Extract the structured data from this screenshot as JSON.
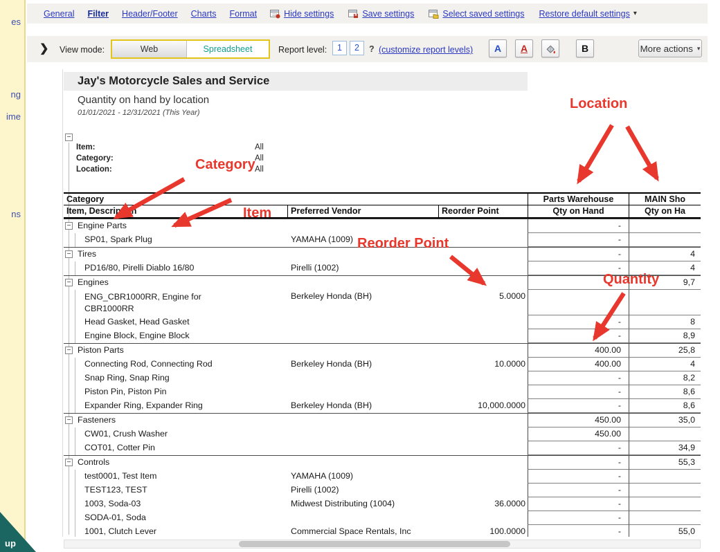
{
  "colors": {
    "link_blue": "#2b38c0",
    "active_tab_blue": "#182d9a",
    "annotation_red": "#e8382d",
    "spreadsheet_teal": "#0f9d8f",
    "toggle_gold_border": "#e3c419",
    "toolbar_bg": "#f2f1ee",
    "sidebar_yellow": "#fdf6cd",
    "corner_teal": "#1b6660"
  },
  "sidebar": {
    "fragments": [
      "es",
      "ng",
      "ime",
      "ns"
    ],
    "corner_label": "up"
  },
  "tabs": [
    {
      "label": "General"
    },
    {
      "label": "Filter"
    },
    {
      "label": "Header/Footer"
    },
    {
      "label": "Charts"
    },
    {
      "label": "Format"
    }
  ],
  "settings_links": [
    {
      "label": "Hide settings"
    },
    {
      "label": "Save settings"
    },
    {
      "label": "Select saved settings"
    },
    {
      "label": "Restore default settings",
      "caret": "▾"
    }
  ],
  "toolbar": {
    "collapse_chevron": "❯",
    "view_mode_label": "View mode:",
    "view_mode_web": "Web",
    "view_mode_spreadsheet": "Spreadsheet",
    "report_level_label": "Report level:",
    "level_1": "1",
    "level_2": "2",
    "help": "?",
    "customize_link": "(customize report levels)",
    "font_button": "A",
    "underline_button": "A",
    "bold_button": "B",
    "more_actions": "More actions",
    "more_actions_caret": "▾"
  },
  "report": {
    "company": "Jay's Motorcycle Sales and Service",
    "title": "Quantity on hand by location",
    "date_range": "01/01/2021 - 12/31/2021 (This Year)",
    "expander_glyph": "−",
    "filters": [
      {
        "label": "Item:",
        "value": "All"
      },
      {
        "label": "Category:",
        "value": "All"
      },
      {
        "label": "Location:",
        "value": "All"
      }
    ],
    "header": {
      "category": "Category",
      "item": "Item, Description",
      "vendor": "Preferred Vendor",
      "reorder": "Reorder Point",
      "loc1": "Parts Warehouse",
      "loc1_sub": "Qty on Hand",
      "loc2": "MAIN Sho",
      "loc2_sub": "Qty on Ha"
    },
    "rows": [
      {
        "type": "category",
        "name": "Engine Parts",
        "vendor": "",
        "reorder": "",
        "qty1": "-",
        "qty2": ""
      },
      {
        "type": "item",
        "name": "SP01, Spark Plug",
        "vendor": "YAMAHA (1009)",
        "reorder": "",
        "qty1": "-",
        "qty2": ""
      },
      {
        "type": "category",
        "name": "Tires",
        "vendor": "",
        "reorder": "",
        "qty1": "-",
        "qty2": "4"
      },
      {
        "type": "item",
        "name": "PD16/80, Pirelli Diablo 16/80",
        "vendor": "Pirelli (1002)",
        "reorder": "",
        "qty1": "-",
        "qty2": "4"
      },
      {
        "type": "category",
        "name": "Engines",
        "vendor": "",
        "reorder": "",
        "qty1": "",
        "qty2": "9,7"
      },
      {
        "type": "item",
        "name": "ENG_CBR1000RR, Engine for CBR1000RR",
        "vendor": "Berkeley Honda (BH)",
        "reorder": "5.0000",
        "qty1": "",
        "qty2": "",
        "tall": true
      },
      {
        "type": "item",
        "name": "Head Gasket, Head Gasket",
        "vendor": "",
        "reorder": "",
        "qty1": "-",
        "qty2": "8"
      },
      {
        "type": "item",
        "name": "Engine Block, Engine Block",
        "vendor": "",
        "reorder": "",
        "qty1": "-",
        "qty2": "8,9"
      },
      {
        "type": "category",
        "name": "Piston Parts",
        "vendor": "",
        "reorder": "",
        "qty1": "400.00",
        "qty2": "25,8"
      },
      {
        "type": "item",
        "name": "Connecting Rod, Connecting Rod",
        "vendor": "Berkeley Honda (BH)",
        "reorder": "10.0000",
        "qty1": "400.00",
        "qty2": "4"
      },
      {
        "type": "item",
        "name": "Snap Ring, Snap Ring",
        "vendor": "",
        "reorder": "",
        "qty1": "-",
        "qty2": "8,2"
      },
      {
        "type": "item",
        "name": "Piston Pin, Piston Pin",
        "vendor": "",
        "reorder": "",
        "qty1": "-",
        "qty2": "8,6"
      },
      {
        "type": "item",
        "name": "Expander Ring, Expander Ring",
        "vendor": "Berkeley Honda (BH)",
        "reorder": "10,000.0000",
        "qty1": "-",
        "qty2": "8,6"
      },
      {
        "type": "category",
        "name": "Fasteners",
        "vendor": "",
        "reorder": "",
        "qty1": "450.00",
        "qty2": "35,0"
      },
      {
        "type": "item",
        "name": "CW01, Crush Washer",
        "vendor": "",
        "reorder": "",
        "qty1": "450.00",
        "qty2": ""
      },
      {
        "type": "item",
        "name": "COT01, Cotter Pin",
        "vendor": "",
        "reorder": "",
        "qty1": "-",
        "qty2": "34,9"
      },
      {
        "type": "category",
        "name": "Controls",
        "vendor": "",
        "reorder": "",
        "qty1": "-",
        "qty2": "55,3"
      },
      {
        "type": "item",
        "name": "test0001, Test Item",
        "vendor": "YAMAHA (1009)",
        "reorder": "",
        "qty1": "-",
        "qty2": ""
      },
      {
        "type": "item",
        "name": "TEST123, TEST",
        "vendor": "Pirelli (1002)",
        "reorder": "",
        "qty1": "-",
        "qty2": ""
      },
      {
        "type": "item",
        "name": "1003, Soda-03",
        "vendor": "Midwest Distributing (1004)",
        "reorder": "36.0000",
        "qty1": "-",
        "qty2": ""
      },
      {
        "type": "item",
        "name": "SODA-01, Soda",
        "vendor": "",
        "reorder": "",
        "qty1": "-",
        "qty2": ""
      },
      {
        "type": "item",
        "name": "1001, Clutch Lever",
        "vendor": "Commercial Space Rentals, Inc",
        "reorder": "100.0000",
        "qty1": "-",
        "qty2": "55,0"
      }
    ]
  },
  "annotations": {
    "location": "Location",
    "category": "Category",
    "item": "Item",
    "reorder_point": "Reorder Point",
    "quantity": "Quantity"
  }
}
